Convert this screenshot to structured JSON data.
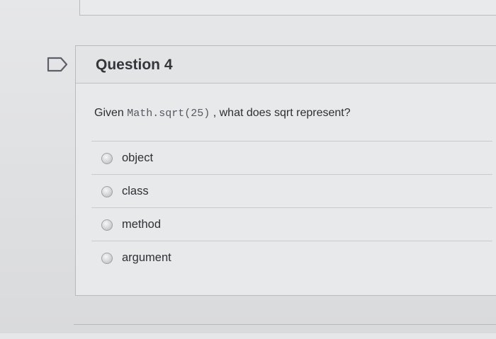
{
  "question": {
    "title": "Question 4",
    "prompt_prefix": "Given",
    "code": "Math.sqrt(25)",
    "prompt_suffix": ", what does sqrt represent?",
    "answers": [
      {
        "label": "object"
      },
      {
        "label": "class"
      },
      {
        "label": "method"
      },
      {
        "label": "argument"
      }
    ]
  }
}
